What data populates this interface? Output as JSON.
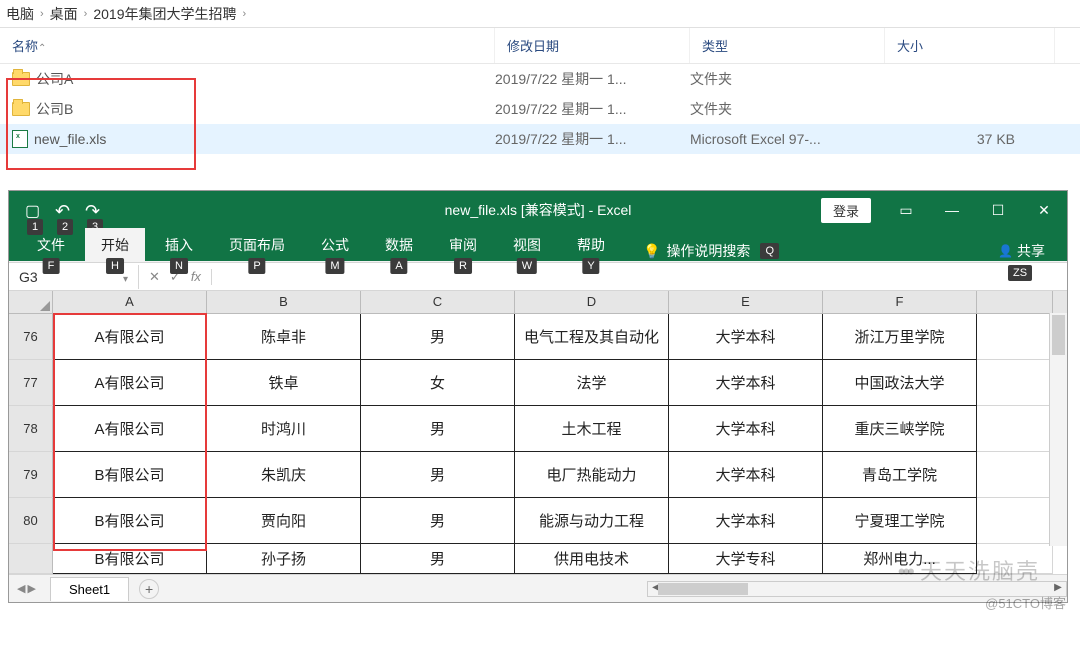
{
  "breadcrumb": {
    "p0": "电脑",
    "p1": "桌面",
    "p2": "2019年集团大学生招聘"
  },
  "headers": {
    "name": "名称",
    "date": "修改日期",
    "type": "类型",
    "size": "大小"
  },
  "files": [
    {
      "name": "公司A",
      "date": "2019/7/22 星期一 1...",
      "type": "文件夹",
      "size": "",
      "icon": "folder"
    },
    {
      "name": "公司B",
      "date": "2019/7/22 星期一 1...",
      "type": "文件夹",
      "size": "",
      "icon": "folder"
    },
    {
      "name": "new_file.xls",
      "date": "2019/7/22 星期一 1...",
      "type": "Microsoft Excel 97-...",
      "size": "37 KB",
      "icon": "xls"
    }
  ],
  "excel": {
    "title": "new_file.xls  [兼容模式]  -  Excel",
    "login": "登录",
    "tabs": {
      "file": "文件",
      "home": "开始",
      "insert": "插入",
      "layout": "页面布局",
      "formula": "公式",
      "data": "数据",
      "review": "审阅",
      "view": "视图",
      "help": "帮助"
    },
    "keys": {
      "qat1": "1",
      "qat2": "2",
      "qat3": "3",
      "file": "F",
      "home": "H",
      "insert": "N",
      "layout": "P",
      "formula": "M",
      "data": "A",
      "review": "R",
      "view": "W",
      "help": "Y",
      "tell": "Q",
      "share": "ZS"
    },
    "tell": "操作说明搜索",
    "share": "共享",
    "namebox": "G3",
    "fx": "fx",
    "cols": {
      "A": "A",
      "B": "B",
      "C": "C",
      "D": "D",
      "E": "E",
      "F": "F",
      "G": ""
    },
    "rows": [
      {
        "n": "76",
        "A": "A有限公司",
        "B": "陈卓非",
        "C": "男",
        "D": "电气工程及其自动化",
        "E": "大学本科",
        "F": "浙江万里学院"
      },
      {
        "n": "77",
        "A": "A有限公司",
        "B": "铁卓",
        "C": "女",
        "D": "法学",
        "E": "大学本科",
        "F": "中国政法大学"
      },
      {
        "n": "78",
        "A": "A有限公司",
        "B": "时鸿川",
        "C": "男",
        "D": "土木工程",
        "E": "大学本科",
        "F": "重庆三峡学院"
      },
      {
        "n": "79",
        "A": "B有限公司",
        "B": "朱凯庆",
        "C": "男",
        "D": "电厂热能动力",
        "E": "大学本科",
        "F": "青岛工学院"
      },
      {
        "n": "80",
        "A": "B有限公司",
        "B": "贾向阳",
        "C": "男",
        "D": "能源与动力工程",
        "E": "大学本科",
        "F": "宁夏理工学院"
      }
    ],
    "lastrow": {
      "n": "",
      "A": "B有限公司",
      "B": "孙子扬",
      "C": "男",
      "D": "供用电技术",
      "E": "大学专科",
      "F": "郑州电力..."
    },
    "sheet": "Sheet1",
    "add": "+"
  },
  "watermark1_a": "•••",
  "watermark1_b": "天天洗脑壳",
  "watermark2": "@51CTO博客"
}
